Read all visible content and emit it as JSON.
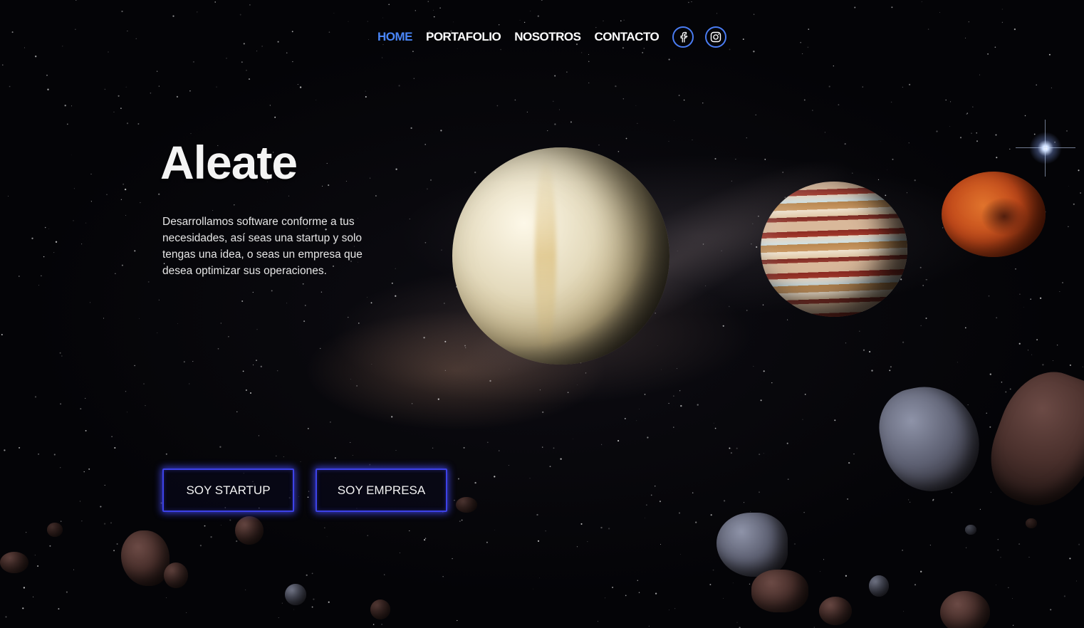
{
  "nav": {
    "items": [
      {
        "label": "HOME",
        "active": true
      },
      {
        "label": "PORTAFOLIO",
        "active": false
      },
      {
        "label": "NOSOTROS",
        "active": false
      },
      {
        "label": "CONTACTO",
        "active": false
      }
    ],
    "social": [
      {
        "icon": "facebook-icon"
      },
      {
        "icon": "instagram-icon"
      }
    ]
  },
  "hero": {
    "title": "Aleate",
    "description": "Desarrollamos software conforme a tus necesidades, así seas una startup y solo tengas una idea, o seas un empresa que desea optimizar sus operaciones.",
    "buttons": {
      "startup": "SOY STARTUP",
      "empresa": "SOY EMPRESA"
    }
  },
  "colors": {
    "accent": "#4a86f7",
    "button_border": "#3d42e8",
    "background": "#050508"
  }
}
